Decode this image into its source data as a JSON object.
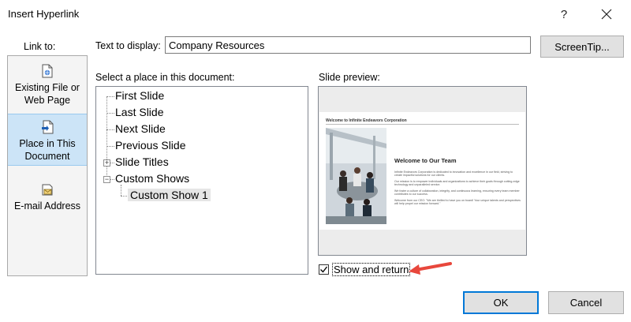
{
  "dialog": {
    "title": "Insert Hyperlink",
    "help_label": "?",
    "close_label": "✕"
  },
  "sidebar": {
    "heading": "Link to:",
    "items": [
      {
        "label": "Existing File or Web Page",
        "icon": "existing-file-icon"
      },
      {
        "label": "Place in This Document",
        "icon": "place-in-document-icon",
        "selected": true
      },
      {
        "label": "E-mail Address",
        "icon": "email-icon"
      }
    ]
  },
  "text_to_display": {
    "label": "Text to display:",
    "value": "Company Resources"
  },
  "screentip_label": "ScreenTip...",
  "place_list": {
    "label": "Select a place in this document:",
    "items": [
      "First Slide",
      "Last Slide",
      "Next Slide",
      "Previous Slide",
      "Slide Titles",
      "Custom Shows",
      "Custom Show 1"
    ],
    "selected": "Custom Show 1"
  },
  "slide_preview": {
    "label": "Slide preview:",
    "slide_header": "Welcome to Infinite Endeavors Corporation",
    "slide_heading": "Welcome to Our Team",
    "bullets": [
      "Infinite Endeavors Corporation is dedicated to innovation and excellence in our field, striving to create impactful solutions for our clients.",
      "Our mission is to empower individuals and organizations to achieve their goals through cutting-edge technology and unparalleled service.",
      "We foster a culture of collaboration, integrity, and continuous learning, ensuring every team member contributes to our success.",
      "Welcome from our CEO: \"We are thrilled to have you on board! Your unique talents and perspectives will help propel our mission forward.\""
    ]
  },
  "show_and_return": {
    "label": "Show and return",
    "checked": true
  },
  "buttons": {
    "ok": "OK",
    "cancel": "Cancel"
  },
  "colors": {
    "selection": "#cce4f7",
    "accent_arrow": "#e8473c",
    "default_button_border": "#0078d7"
  }
}
